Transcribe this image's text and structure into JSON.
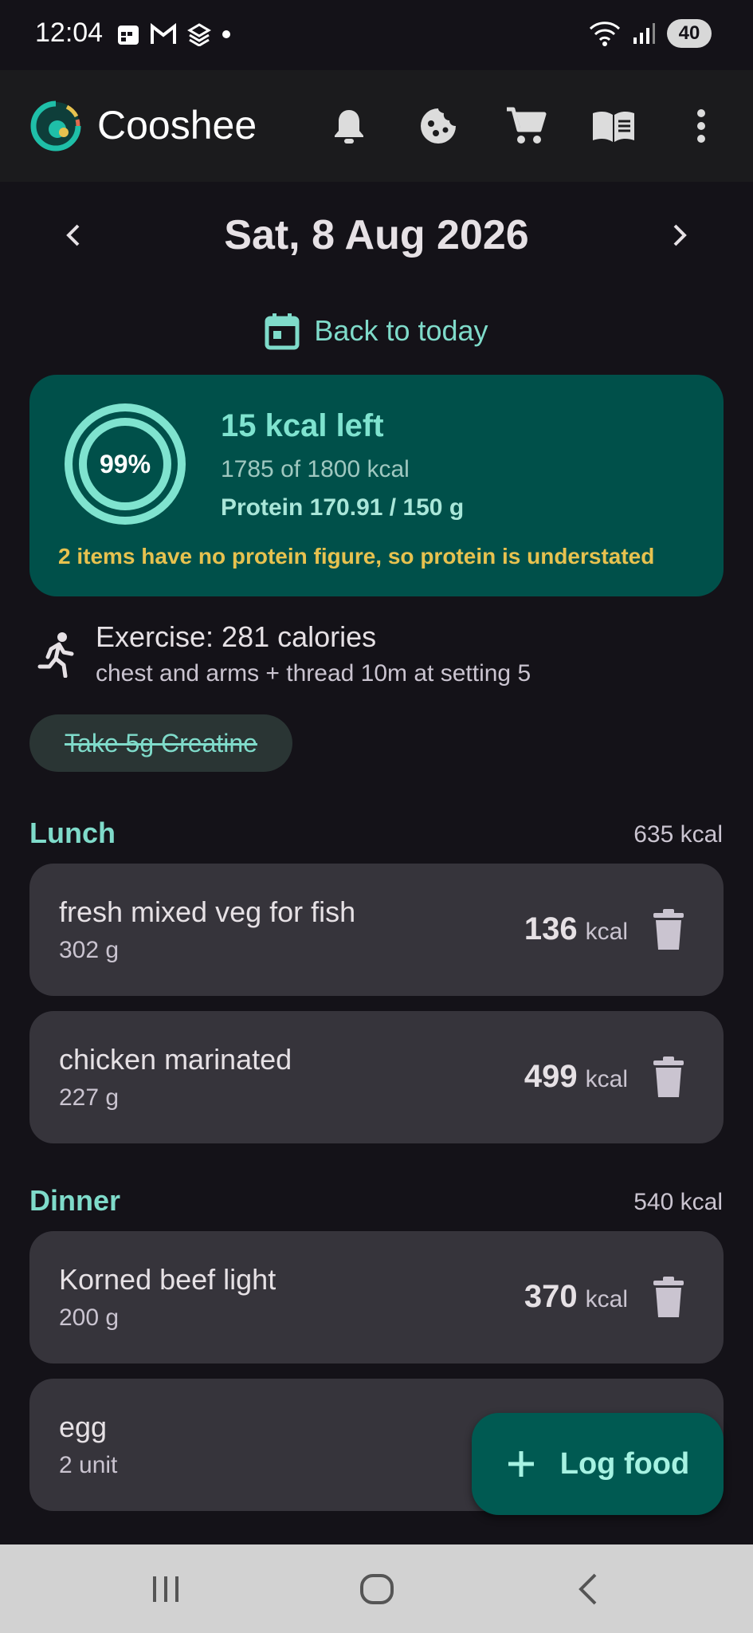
{
  "status_bar": {
    "time": "12:04",
    "battery": "40"
  },
  "app_bar": {
    "title": "Cooshee"
  },
  "date_nav": {
    "date": "Sat, 8 Aug 2026",
    "back_to_today": "Back to today"
  },
  "summary": {
    "ring_percent_label": "99%",
    "ring_progress": 0.99,
    "kcal_left": "15 kcal left",
    "kcal_of": "1785 of 1800 kcal",
    "protein": "Protein 170.91 / 150 g",
    "warning": "2 items have no protein figure, so protein is understated"
  },
  "exercise": {
    "title": "Exercise: 281 calories",
    "subtitle": "chest and arms + thread 10m at setting 5"
  },
  "reminder_chip": {
    "label": "Take 5g Creatine"
  },
  "meals": [
    {
      "name": "Lunch",
      "total": "635 kcal",
      "items": [
        {
          "name": "fresh mixed veg for fish",
          "qty": "302 g",
          "kcal": "136",
          "unit": "kcal"
        },
        {
          "name": "chicken marinated",
          "qty": "227 g",
          "kcal": "499",
          "unit": "kcal"
        }
      ]
    },
    {
      "name": "Dinner",
      "total": "540 kcal",
      "items": [
        {
          "name": "Korned beef light",
          "qty": "200 g",
          "kcal": "370",
          "unit": "kcal"
        },
        {
          "name": "egg",
          "qty": "2 unit"
        }
      ]
    }
  ],
  "fab": {
    "label": "Log food"
  },
  "colors": {
    "accent": "#7fdbca",
    "card": "#36343b",
    "summary_bg": "#00504a",
    "warning": "#e7c24f"
  }
}
